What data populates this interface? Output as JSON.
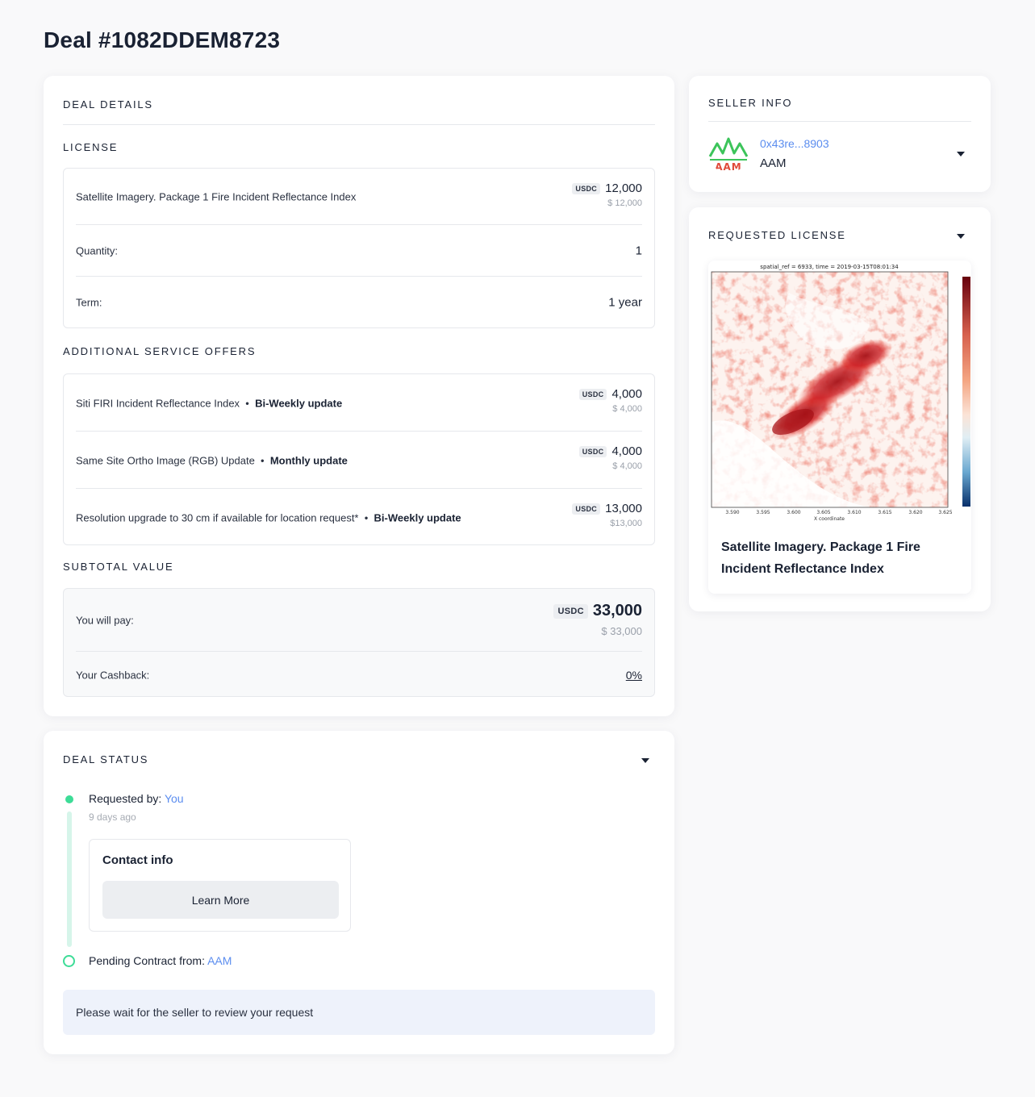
{
  "page_title": "Deal #1082DDEM8723",
  "deal_details": {
    "heading": "DEAL DETAILS",
    "license": {
      "heading": "LICENSE",
      "item": {
        "name": "Satellite Imagery. Package 1 Fire Incident Reflectance Index",
        "currency": "USDC",
        "amount": "12,000",
        "usd": "$ 12,000"
      },
      "quantity_label": "Quantity:",
      "quantity_value": "1",
      "term_label": "Term:",
      "term_value": "1 year"
    },
    "additional": {
      "heading": "ADDITIONAL SERVICE OFFERS",
      "items": [
        {
          "name": "Siti FIRI Incident Reflectance Index",
          "sep": "•",
          "update": "Bi-Weekly update",
          "currency": "USDC",
          "amount": "4,000",
          "usd": "$ 4,000"
        },
        {
          "name": "Same Site Ortho Image (RGB) Update",
          "sep": "•",
          "update": "Monthly update",
          "currency": "USDC",
          "amount": "4,000",
          "usd": "$ 4,000"
        },
        {
          "name": "Resolution upgrade to 30 cm if available for location request*",
          "sep": "•",
          "update": "Bi-Weekly update",
          "currency": "USDC",
          "amount": "13,000",
          "usd": "$13,000"
        }
      ]
    },
    "subtotal": {
      "heading": "SUBTOTAL VALUE",
      "pay_label": "You will pay:",
      "currency": "USDC",
      "amount": "33,000",
      "usd": "$ 33,000",
      "cashback_label": "Your Cashback:",
      "cashback_value": "0%"
    }
  },
  "deal_status": {
    "heading": "DEAL STATUS",
    "requested_label": "Requested by:",
    "requested_by": "You",
    "requested_time": "9 days ago",
    "contact_title": "Contact info",
    "learn_more": "Learn More",
    "pending_label": "Pending Contract from:",
    "pending_from": "AAM",
    "notice": "Please wait for the seller to review your request"
  },
  "seller_info": {
    "heading": "SELLER INFO",
    "address": "0x43re...8903",
    "name": "AAM",
    "logo_text": "AAM"
  },
  "requested_license": {
    "heading": "REQUESTED LICENSE",
    "title": "Satellite Imagery. Package 1 Fire Incident Reflectance Index",
    "plot_title": "spatial_ref = 6933, time = 2019-03-15T08:01:34",
    "x_ticks": [
      "3.590",
      "3.595",
      "3.600",
      "3.605",
      "3.610",
      "3.615",
      "3.620",
      "3.625"
    ],
    "x_label": "X coordinate"
  },
  "colors": {
    "link": "#5b8def",
    "status_green": "#3ddc97",
    "timeline_line": "#d6f5ea"
  }
}
